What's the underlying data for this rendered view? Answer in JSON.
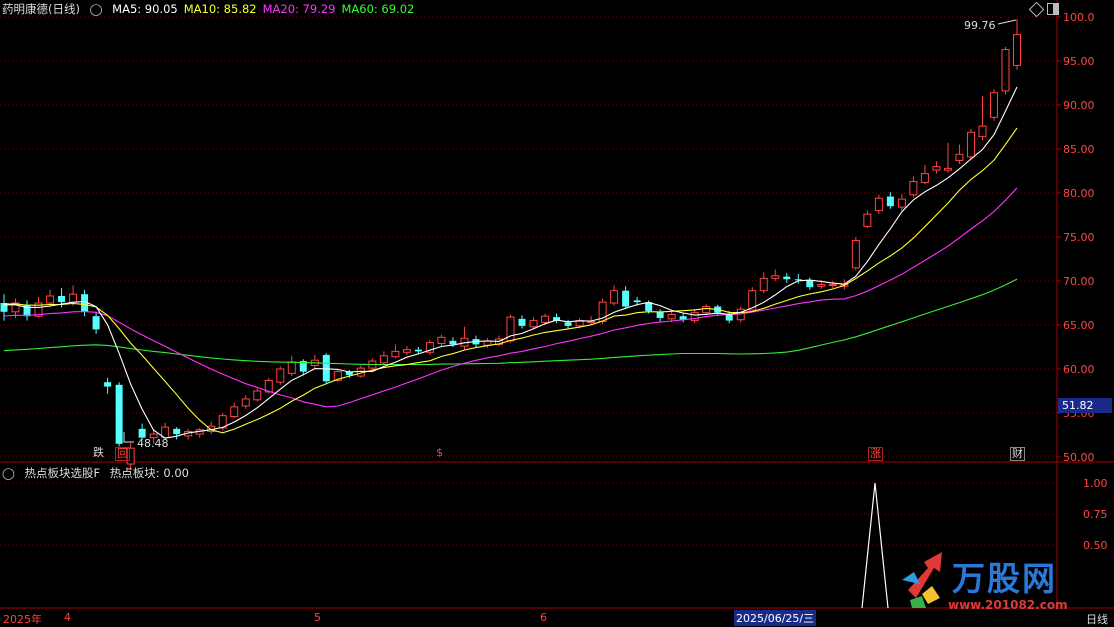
{
  "main_chart": {
    "stock_name": "药明康德(日线)",
    "ma_legend": [
      {
        "label": "MA5: 90.05",
        "color": "#ffffff"
      },
      {
        "label": "MA10: 85.82",
        "color": "#ffff33"
      },
      {
        "label": "MA20: 79.29",
        "color": "#ff33ff"
      },
      {
        "label": "MA60: 69.02",
        "color": "#33ff33"
      }
    ],
    "price_axis": [
      "100.0",
      "95.00",
      "90.00",
      "85.00",
      "80.00",
      "75.00",
      "70.00",
      "65.00",
      "60.00",
      "55.00",
      "50.00"
    ],
    "current_price_tag": "51.82",
    "high_annotation": "99.76",
    "low_annotation": "48.48",
    "signal_markers": [
      {
        "text": "跌",
        "color": "#dddddd"
      },
      {
        "text": "回",
        "color": "#ff4444"
      },
      {
        "text": "$",
        "color": "#ff4444"
      },
      {
        "text": "涨",
        "color": "#ff4444"
      },
      {
        "text": "财",
        "color": "#dddddd"
      }
    ],
    "colors": {
      "up": "#ff4444",
      "down": "#54ffff",
      "grid": "#7a0000",
      "border": "#aa0000"
    }
  },
  "sub_chart": {
    "title": "热点板块选股F",
    "value_label": "热点板块: 0.00",
    "axis": [
      "1.00",
      "0.75",
      "0.50"
    ]
  },
  "time_axis": {
    "labels": [
      "2025年",
      "4",
      "5",
      "6"
    ],
    "cursor_date": "2025/06/25/三",
    "period_label": "日线"
  },
  "watermark": {
    "brand": "万股网",
    "url": "www.201082.com"
  },
  "icons": [
    "diamond-icon",
    "window-toggle-icon",
    "collapse-icon"
  ]
}
